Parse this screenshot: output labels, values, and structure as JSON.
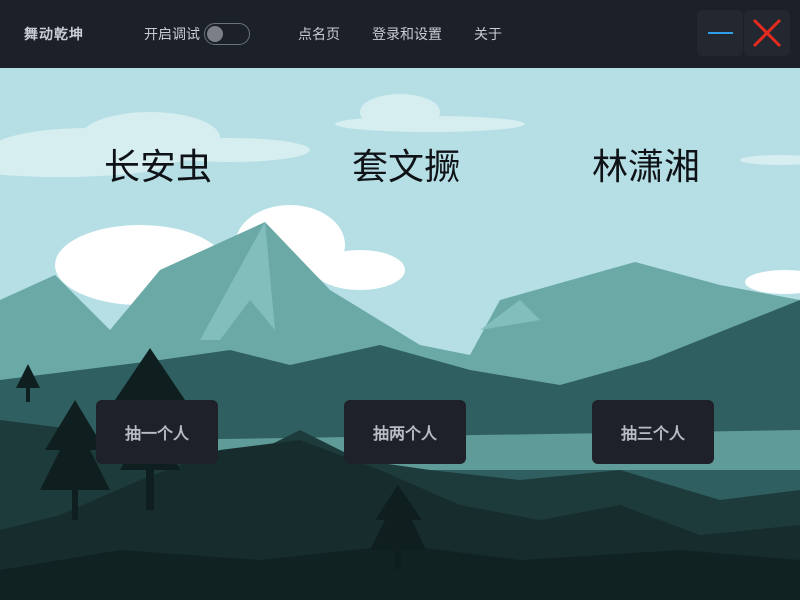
{
  "app": {
    "title": "舞动乾坤"
  },
  "debug": {
    "label": "开启调试",
    "enabled": false
  },
  "nav": [
    {
      "label": "点名页"
    },
    {
      "label": "登录和设置"
    },
    {
      "label": "关于"
    }
  ],
  "window": {
    "minimize_icon": "minimize-icon",
    "close_icon": "close-icon",
    "accent": "#2f9ee8",
    "close_color": "#e52b20"
  },
  "names": [
    "长安虫",
    "套文撅",
    "林潇湘"
  ],
  "buttons": [
    "抽一个人",
    "抽两个人",
    "抽三个人"
  ]
}
